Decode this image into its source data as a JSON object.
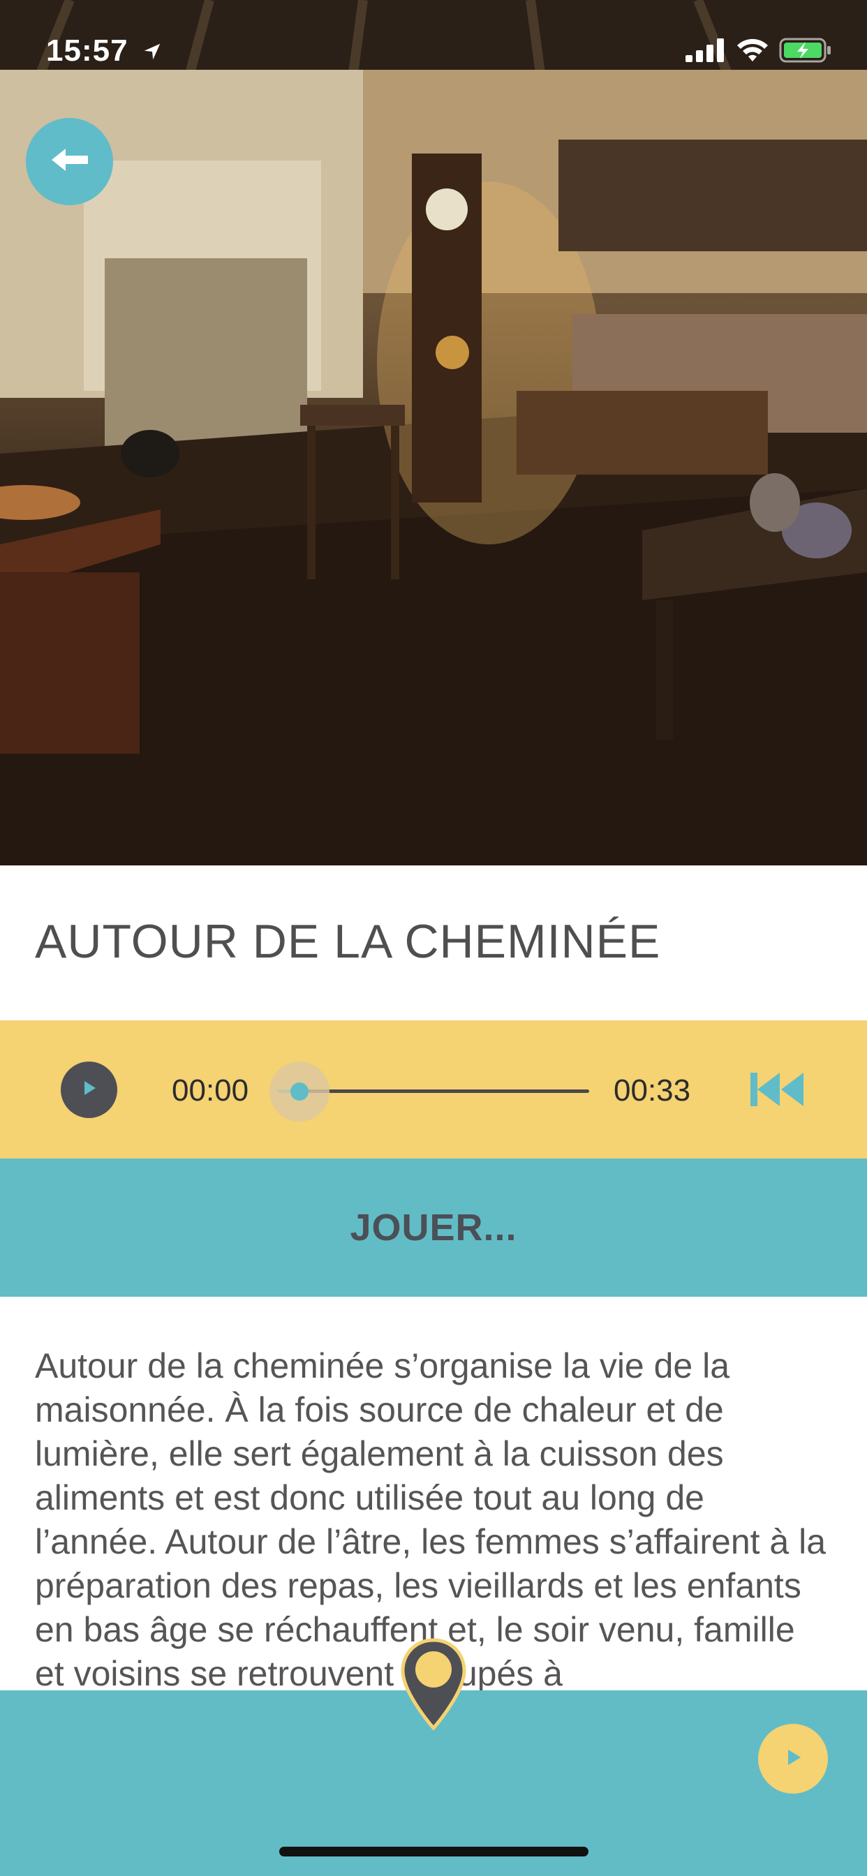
{
  "status_bar": {
    "time": "15:57",
    "icons": [
      "location-arrow-icon",
      "signal-icon",
      "wifi-icon",
      "battery-charging-icon"
    ]
  },
  "hero": {
    "image_alt": "Intérieur d'une maison ancienne avec cheminée"
  },
  "back_button": {
    "icon": "arrow-left-icon"
  },
  "title": "AUTOUR DE LA CHEMINÉE",
  "audio_player": {
    "current_time": "00:00",
    "total_time": "00:33",
    "progress": 0.07,
    "play_icon": "play-icon",
    "rewind_icon": "skip-back-icon"
  },
  "play_banner": {
    "label": "JOUER..."
  },
  "description": "Autour de la cheminée s’organise la vie de la maisonnée. À la fois source de chaleur et de lumière, elle sert également à la cuisson des aliments et est donc utilisée tout au long de l’année. Autour de l’âtre, les femmes s’affairent à la préparation des repas, les vieillards et les enfants en bas âge se réchauffent et, le soir venu, famille et voisins se retrouvent occupés à",
  "bottom_bar": {
    "pin_icon": "map-pin-icon",
    "next_icon": "play-icon"
  },
  "colors": {
    "accent_teal": "#5fbcc8",
    "player_yellow": "#f5d272",
    "dark_button": "#4d4f54",
    "text_gray": "#555555"
  }
}
